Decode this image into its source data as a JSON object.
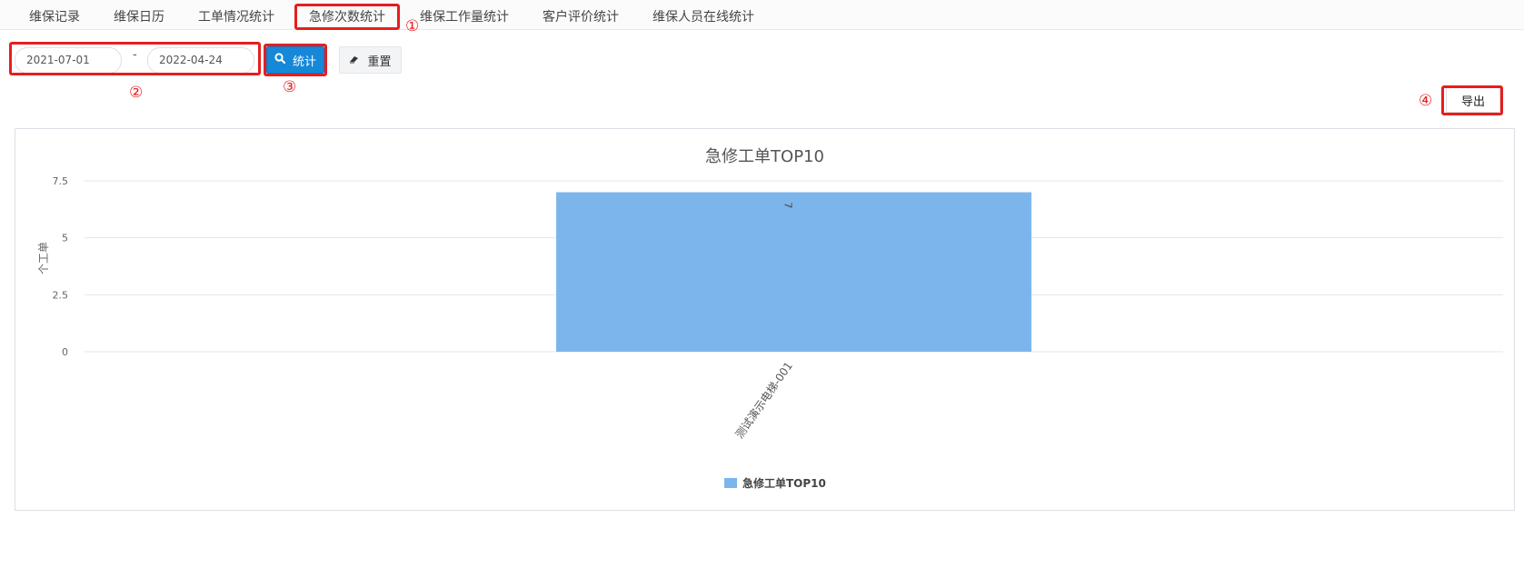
{
  "tabs": [
    {
      "label": "维保记录"
    },
    {
      "label": "维保日历"
    },
    {
      "label": "工单情况统计"
    },
    {
      "label": "急修次数统计"
    },
    {
      "label": "维保工作量统计"
    },
    {
      "label": "客户评价统计"
    },
    {
      "label": "维保人员在线统计"
    }
  ],
  "filters": {
    "start_date": "2021-07-01",
    "end_date": "2022-04-24",
    "separator": "-",
    "search_label": "统计",
    "reset_label": "重置"
  },
  "export_label": "导出",
  "annotations": [
    "①",
    "②",
    "③",
    "④"
  ],
  "colors": {
    "accent": "#1588d8",
    "annotation": "#e61e1e",
    "bar": "#7cb5ec"
  },
  "icons": {
    "search": "search-icon",
    "reset": "eraser-icon"
  },
  "chart_data": {
    "type": "bar",
    "title": "急修工单TOP10",
    "ylabel": "个工单",
    "xlabel": "",
    "categories": [
      "测试演示电梯-001"
    ],
    "series": [
      {
        "name": "急修工单TOP10",
        "values": [
          7
        ],
        "color": "#7cb5ec"
      }
    ],
    "ylim": [
      0,
      7.5
    ],
    "yticks": [
      0,
      2.5,
      5,
      7.5
    ],
    "ytick_labels": [
      "0",
      "2.5",
      "5",
      "7.5"
    ],
    "grid": true,
    "legend": "bottom-center",
    "data_labels": [
      "7"
    ]
  }
}
